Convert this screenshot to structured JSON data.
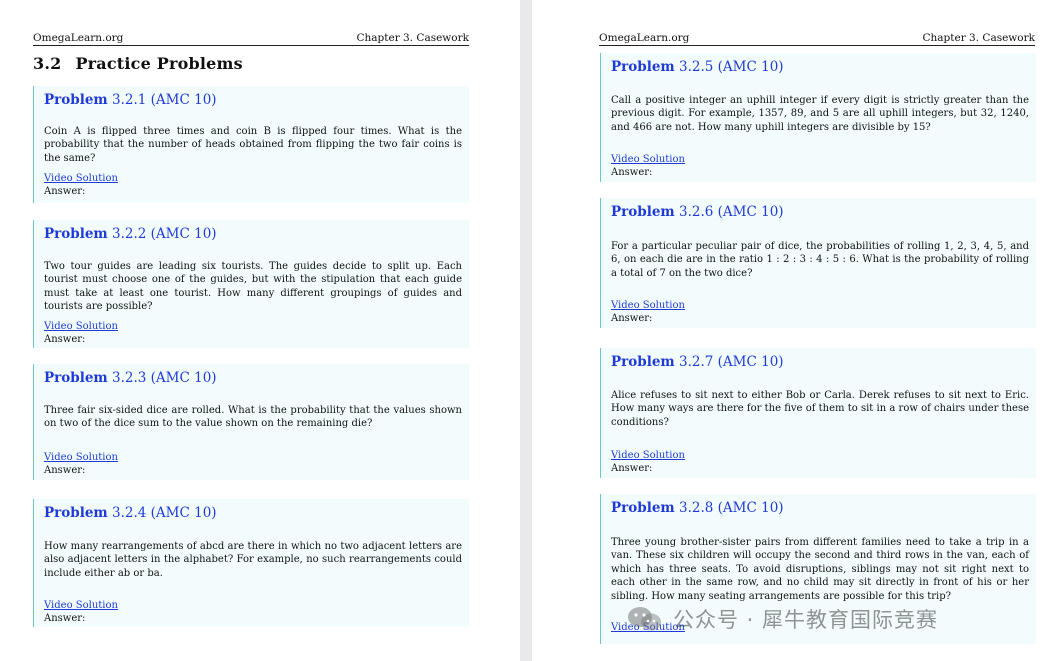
{
  "header": {
    "site": "OmegaLearn.org",
    "chapter": "Chapter 3.   Casework"
  },
  "section": {
    "number": "3.2",
    "title": "Practice Problems"
  },
  "problems": [
    {
      "label": "Problem",
      "number": "3.2.1 (AMC 10)",
      "text": "Coin A is flipped three times and coin B is flipped four times.  What is the probability that the number of heads obtained from flipping the two fair coins is the same?",
      "video": "Video Solution",
      "answer": "Answer:"
    },
    {
      "label": "Problem",
      "number": "3.2.2 (AMC 10)",
      "text": "Two tour guides are leading six tourists.  The guides decide to split up.  Each tourist must choose one of the guides, but with the stipulation that each guide must take at least one tourist.  How many different groupings of guides and tourists are possible?",
      "video": "Video Solution",
      "answer": "Answer:"
    },
    {
      "label": "Problem",
      "number": "3.2.3 (AMC 10)",
      "text": "Three fair six-sided dice are rolled.  What is the probability that the values shown on two of the dice sum to the value shown on the remaining die?",
      "video": "Video Solution",
      "answer": "Answer:"
    },
    {
      "label": "Problem",
      "number": "3.2.4 (AMC 10)",
      "text": "How many rearrangements of abcd are there in which no two adjacent letters are also adjacent letters in the alphabet?  For example, no such rearrangements could include either ab or ba.",
      "video": "Video Solution",
      "answer": "Answer:"
    },
    {
      "label": "Problem",
      "number": "3.2.5 (AMC 10)",
      "text": "Call a positive integer an uphill integer if every digit is strictly greater than the previous digit.  For example, 1357, 89, and 5 are all uphill integers, but 32, 1240, and 466 are not.  How many uphill integers are divisible by 15?",
      "video": "Video Solution",
      "answer": "Answer:"
    },
    {
      "label": "Problem",
      "number": "3.2.6 (AMC 10)",
      "text": "For a particular peculiar pair of dice, the probabilities of rolling 1, 2, 3, 4, 5, and 6, on each die are in the ratio 1 : 2 : 3 : 4 : 5 : 6.  What is the probability of rolling a total of 7 on the two dice?",
      "video": "Video Solution",
      "answer": "Answer:"
    },
    {
      "label": "Problem",
      "number": "3.2.7 (AMC 10)",
      "text": "Alice refuses to sit next to either Bob or Carla.  Derek refuses to sit next to Eric.  How many ways are there for the five of them to sit in a row of chairs under these conditions?",
      "video": "Video Solution",
      "answer": "Answer:"
    },
    {
      "label": "Problem",
      "number": "3.2.8 (AMC 10)",
      "text": "Three young brother-sister pairs from different families need to take a trip in a van.  These six children will occupy the second and third rows in the van, each of which has three seats.  To avoid disruptions, siblings may not sit right next to each other in the same row, and no child may sit directly in front of his or her sibling.  How many seating arrangements are possible for this trip?",
      "video": "Video Solution",
      "answer": ""
    }
  ],
  "watermark": {
    "text": "公众号 · 犀牛教育国际竞赛",
    "icon": "wechat-icon"
  }
}
